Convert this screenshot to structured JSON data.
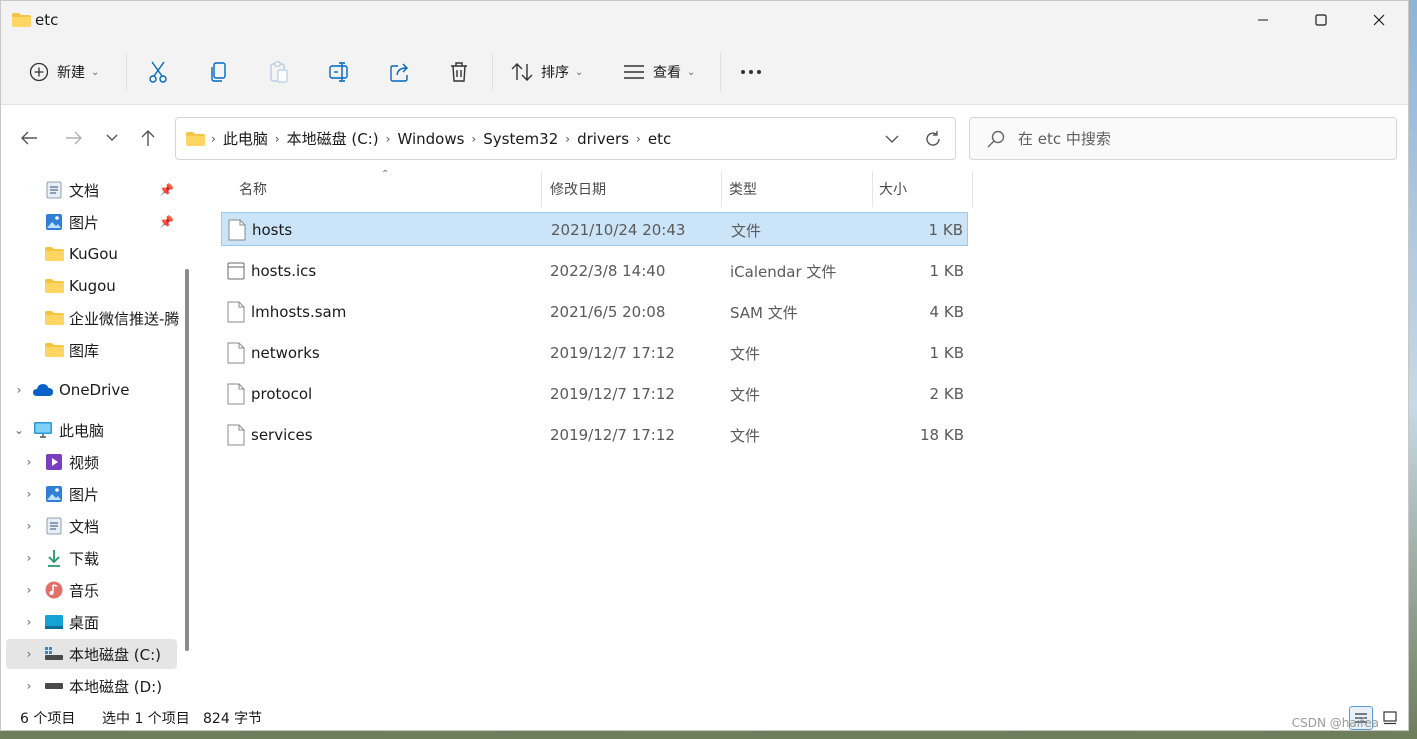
{
  "window": {
    "title": "etc",
    "min_icon": "minimize-icon",
    "max_icon": "maximize-icon",
    "close_icon": "close-icon"
  },
  "toolbar": {
    "new_label": "新建",
    "sort_label": "排序",
    "view_label": "查看",
    "more_icon": "more-icon"
  },
  "address": {
    "crumbs": [
      "此电脑",
      "本地磁盘 (C:)",
      "Windows",
      "System32",
      "drivers",
      "etc"
    ]
  },
  "search": {
    "placeholder": "在 etc 中搜索"
  },
  "sidebar": {
    "items": [
      {
        "label": "文档",
        "icon": "document-icon",
        "pinned": true
      },
      {
        "label": "图片",
        "icon": "pictures-icon",
        "pinned": true
      },
      {
        "label": "KuGou",
        "icon": "folder-icon"
      },
      {
        "label": "Kugou",
        "icon": "folder-icon"
      },
      {
        "label": "企业微信推送-腾",
        "icon": "folder-icon"
      },
      {
        "label": "图库",
        "icon": "folder-icon"
      },
      {
        "label": "OneDrive",
        "icon": "onedrive-icon"
      },
      {
        "label": "此电脑",
        "icon": "this-pc-icon"
      },
      {
        "label": "视频",
        "icon": "video-icon"
      },
      {
        "label": "图片",
        "icon": "pictures-icon"
      },
      {
        "label": "文档",
        "icon": "document-icon"
      },
      {
        "label": "下载",
        "icon": "download-icon"
      },
      {
        "label": "音乐",
        "icon": "music-icon"
      },
      {
        "label": "桌面",
        "icon": "desktop-icon"
      },
      {
        "label": "本地磁盘 (C:)",
        "icon": "drive-icon"
      },
      {
        "label": "本地磁盘 (D:)",
        "icon": "drive-icon"
      }
    ]
  },
  "columns": {
    "name": "名称",
    "date": "修改日期",
    "type": "类型",
    "size": "大小"
  },
  "files": [
    {
      "name": "hosts",
      "date": "2021/10/24 20:43",
      "type": "文件",
      "size": "1 KB",
      "selected": true
    },
    {
      "name": "hosts.ics",
      "date": "2022/3/8 14:40",
      "type": "iCalendar 文件",
      "size": "1 KB"
    },
    {
      "name": "lmhosts.sam",
      "date": "2021/6/5 20:08",
      "type": "SAM 文件",
      "size": "4 KB"
    },
    {
      "name": "networks",
      "date": "2019/12/7 17:12",
      "type": "文件",
      "size": "1 KB"
    },
    {
      "name": "protocol",
      "date": "2019/12/7 17:12",
      "type": "文件",
      "size": "2 KB"
    },
    {
      "name": "services",
      "date": "2019/12/7 17:12",
      "type": "文件",
      "size": "18 KB"
    }
  ],
  "status": {
    "item_count": "6 个项目",
    "selection": "选中 1 个项目",
    "size": "824 字节"
  },
  "watermark": "CSDN @haifea",
  "colors": {
    "selection_bg": "#cce4f7",
    "folder_yellow": "#f4c545",
    "accent": "#0067c0"
  }
}
